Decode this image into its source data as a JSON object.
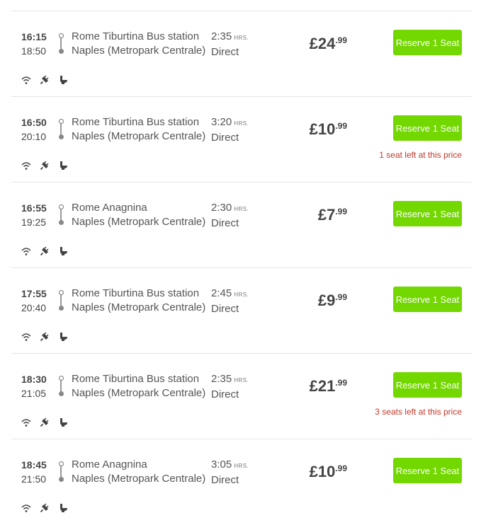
{
  "rides": [
    {
      "departure": "16:15",
      "arrival": "18:50",
      "from": "Rome Tiburtina Bus station",
      "to": "Naples (Metropark Centrale)",
      "duration": "2:35",
      "duration_unit": "HRS.",
      "transfer": "Direct",
      "price_main": "£24",
      "price_cents": ".99",
      "button": "Reserve 1 Seat",
      "notice": ""
    },
    {
      "departure": "16:50",
      "arrival": "20:10",
      "from": "Rome Tiburtina Bus station",
      "to": "Naples (Metropark Centrale)",
      "duration": "3:20",
      "duration_unit": "HRS.",
      "transfer": "Direct",
      "price_main": "£10",
      "price_cents": ".99",
      "button": "Reserve 1 Seat",
      "notice": "1 seat left at this price"
    },
    {
      "departure": "16:55",
      "arrival": "19:25",
      "from": "Rome Anagnina",
      "to": "Naples (Metropark Centrale)",
      "duration": "2:30",
      "duration_unit": "HRS.",
      "transfer": "Direct",
      "price_main": "£7",
      "price_cents": ".99",
      "button": "Reserve 1 Seat",
      "notice": ""
    },
    {
      "departure": "17:55",
      "arrival": "20:40",
      "from": "Rome Tiburtina Bus station",
      "to": "Naples (Metropark Centrale)",
      "duration": "2:45",
      "duration_unit": "HRS.",
      "transfer": "Direct",
      "price_main": "£9",
      "price_cents": ".99",
      "button": "Reserve 1 Seat",
      "notice": ""
    },
    {
      "departure": "18:30",
      "arrival": "21:05",
      "from": "Rome Tiburtina Bus station",
      "to": "Naples (Metropark Centrale)",
      "duration": "2:35",
      "duration_unit": "HRS.",
      "transfer": "Direct",
      "price_main": "£21",
      "price_cents": ".99",
      "button": "Reserve 1 Seat",
      "notice": "3 seats left at this price"
    },
    {
      "departure": "18:45",
      "arrival": "21:50",
      "from": "Rome Anagnina",
      "to": "Naples (Metropark Centrale)",
      "duration": "3:05",
      "duration_unit": "HRS.",
      "transfer": "Direct",
      "price_main": "£10",
      "price_cents": ".99",
      "button": "Reserve 1 Seat",
      "notice": ""
    }
  ],
  "amenities": [
    "wifi-icon",
    "power-plug-icon",
    "toilet-icon"
  ],
  "colors": {
    "accent": "#73d700",
    "notice": "#c0392b",
    "divider": "#e5e5e5",
    "text": "#444444"
  }
}
